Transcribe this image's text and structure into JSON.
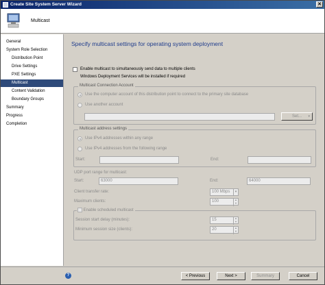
{
  "window": {
    "title": "Create Site System Server Wizard",
    "close_glyph": "✕"
  },
  "header": {
    "page": "Multicast"
  },
  "nav": {
    "items": [
      {
        "label": "General",
        "indent": 0
      },
      {
        "label": "System Role Selection",
        "indent": 0
      },
      {
        "label": "Distribution Point",
        "indent": 1
      },
      {
        "label": "Drive Settings",
        "indent": 1
      },
      {
        "label": "PXE Settings",
        "indent": 1
      },
      {
        "label": "Multicast",
        "indent": 1,
        "selected": true
      },
      {
        "label": "Content Validation",
        "indent": 1
      },
      {
        "label": "Boundary Groups",
        "indent": 1
      },
      {
        "label": "Summary",
        "indent": 0
      },
      {
        "label": "Progress",
        "indent": 0
      },
      {
        "label": "Completion",
        "indent": 0
      }
    ]
  },
  "content": {
    "heading": "Specify multicast settings for operating system deployment",
    "enable_multicast": {
      "label": "Enable multicast to simultaneously send data to multiple clients",
      "checked": false
    },
    "wds_note": "Windows Deployment Services will be installed if required",
    "connection_account": {
      "title": "Multicast Connection Account",
      "option1": "Use the computer account of this distribution point to connect to the primary site database",
      "option2": "Use another account",
      "account_value": "",
      "set_button": "Set..."
    },
    "address_settings": {
      "title": "Multicast address settings",
      "option1": "Use IPv4 addresses within any range",
      "option2": "Use IPv4 addresses from the following range",
      "start_label": "Start:",
      "start_value": "",
      "end_label": "End:",
      "end_value": ""
    },
    "udp": {
      "title": "UDP port range for multicast:",
      "start_label": "Start:",
      "start_value": "63000",
      "end_label": "End:",
      "end_value": "64000"
    },
    "transfer_rate": {
      "label": "Client transfer rate:",
      "value": "100 Mbps"
    },
    "max_clients": {
      "label": "Maximum clients:",
      "value": "100"
    },
    "scheduled": {
      "title": "Enable scheduled multicast",
      "delay_label": "Session start delay (minutes):",
      "delay_value": "15",
      "size_label": "Minimum session size (clients):",
      "size_value": "20"
    }
  },
  "footer": {
    "help_glyph": "?",
    "previous": "< Previous",
    "next": "Next >",
    "summary": "Summary",
    "cancel": "Cancel"
  },
  "colors": {
    "title_bar": "#0a246a",
    "heading": "#1f3c8c",
    "nav_selected": "#2e4a7a",
    "face": "#d4d0c8"
  }
}
